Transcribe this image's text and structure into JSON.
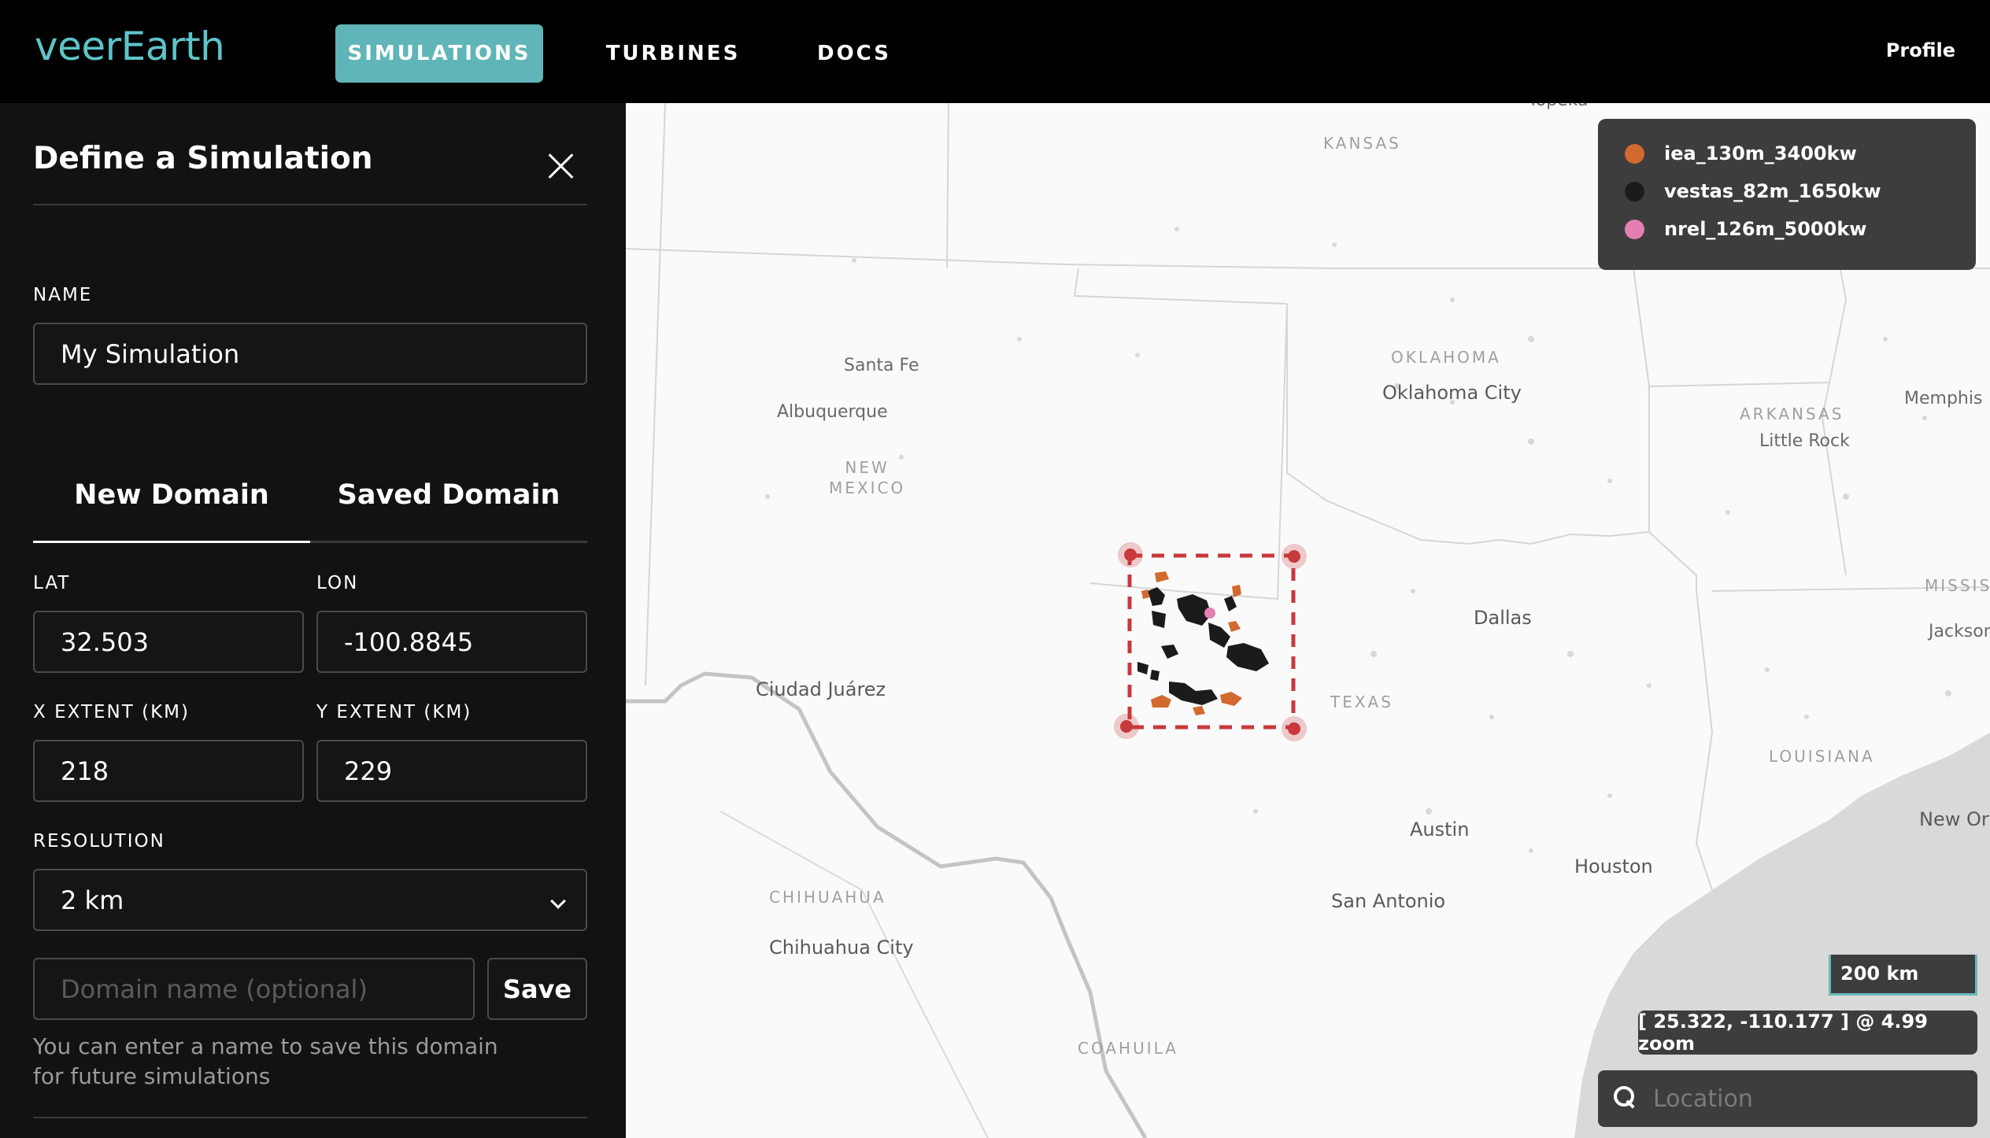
{
  "app": {
    "logo": "veerEarth",
    "nav": {
      "simulations": "SIMULATIONS",
      "turbines": "TURBINES",
      "docs": "DOCS"
    },
    "profile": "Profile"
  },
  "panel": {
    "title": "Define a Simulation",
    "name_label": "NAME",
    "name_value": "My Simulation",
    "tabs": {
      "new": "New Domain",
      "saved": "Saved Domain"
    },
    "lat_label": "LAT",
    "lat_value": "32.503",
    "lon_label": "LON",
    "lon_value": "-100.8845",
    "x_extent_label": "X EXTENT (KM)",
    "x_extent_value": "218",
    "y_extent_label": "Y EXTENT (KM)",
    "y_extent_value": "229",
    "resolution_label": "RESOLUTION",
    "resolution_value": "2 km",
    "domain_name_placeholder": "Domain name (optional)",
    "save_label": "Save",
    "help_text": "You can enter a name to save this domain for future simulations"
  },
  "map": {
    "states": {
      "kansas": "KANSAS",
      "oklahoma": "OKLAHOMA",
      "arkansas": "ARKANSAS",
      "new_mexico": "NEW\nMEXICO",
      "texas": "TEXAS",
      "louisiana": "LOUISIANA",
      "mississippi": "MISSIS",
      "chihuahua": "CHIHUAHUA",
      "coahuila": "COAHUILA"
    },
    "cities": {
      "topeka": "Topeka",
      "santa_fe": "Santa Fe",
      "albuquerque": "Albuquerque",
      "oklahoma_city": "Oklahoma City",
      "memphis": "Memphis",
      "little_rock": "Little Rock",
      "dallas": "Dallas",
      "jackson": "Jackson",
      "ciudad_juarez": "Ciudad Juárez",
      "austin": "Austin",
      "houston": "Houston",
      "new_orleans": "New Orl",
      "san_antonio": "San Antonio",
      "chihuahua_city": "Chihuahua City"
    },
    "legend": [
      {
        "name": "iea_130m_3400kw",
        "color": "#d2692e"
      },
      {
        "name": "vestas_82m_1650kw",
        "color": "#1b1b1b"
      },
      {
        "name": "nrel_126m_5000kw",
        "color": "#e57fb3"
      }
    ],
    "scale": "200 km",
    "coords": "[ 25.322, -110.177 ] @ 4.99 zoom",
    "search_placeholder": "Location",
    "colors": {
      "accent": "#5fb5b7",
      "domain_box": "#c8393b",
      "map_bg": "#fafafa"
    }
  }
}
